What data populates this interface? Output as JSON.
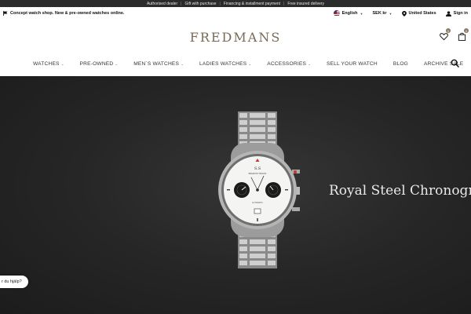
{
  "topbar": {
    "items": [
      "Authorised dealer",
      "Gift with purchase",
      "Financing & installment payment",
      "Free insured delivery"
    ],
    "separator": "|"
  },
  "utility": {
    "promo_text": "Concept watch shop. New & pre-owned watches online.",
    "language": "English",
    "currency": "SEK kr",
    "country": "United States",
    "sign_in": "Sign in"
  },
  "brand": {
    "logo_text": "FREDMANS",
    "wishlist_count": "0",
    "cart_count": "0"
  },
  "nav": {
    "items": [
      {
        "label": "WATCHES",
        "dropdown": true
      },
      {
        "label": "PRE-OWNED",
        "dropdown": true
      },
      {
        "label": "MEN´S WATCHES",
        "dropdown": true
      },
      {
        "label": "LADIES WATCHES",
        "dropdown": true
      },
      {
        "label": "ACCESSORIES",
        "dropdown": true
      },
      {
        "label": "SELL YOUR WATCH",
        "dropdown": false
      },
      {
        "label": "BLOG",
        "dropdown": false
      },
      {
        "label": "ARCHIVE SALE",
        "dropdown": false
      }
    ]
  },
  "hero": {
    "title": "Royal Steel Chronogra",
    "dial_logo": "S.S",
    "dial_brand": "BREMONT BRAND",
    "dial_model": "AUTOMATIC",
    "background_color": "#262626"
  },
  "help_widget": {
    "label": "r du hjälp?"
  },
  "colors": {
    "topbar": "#2b2b2b",
    "brand": "#7a6a55",
    "badge": "#8a7a63"
  }
}
